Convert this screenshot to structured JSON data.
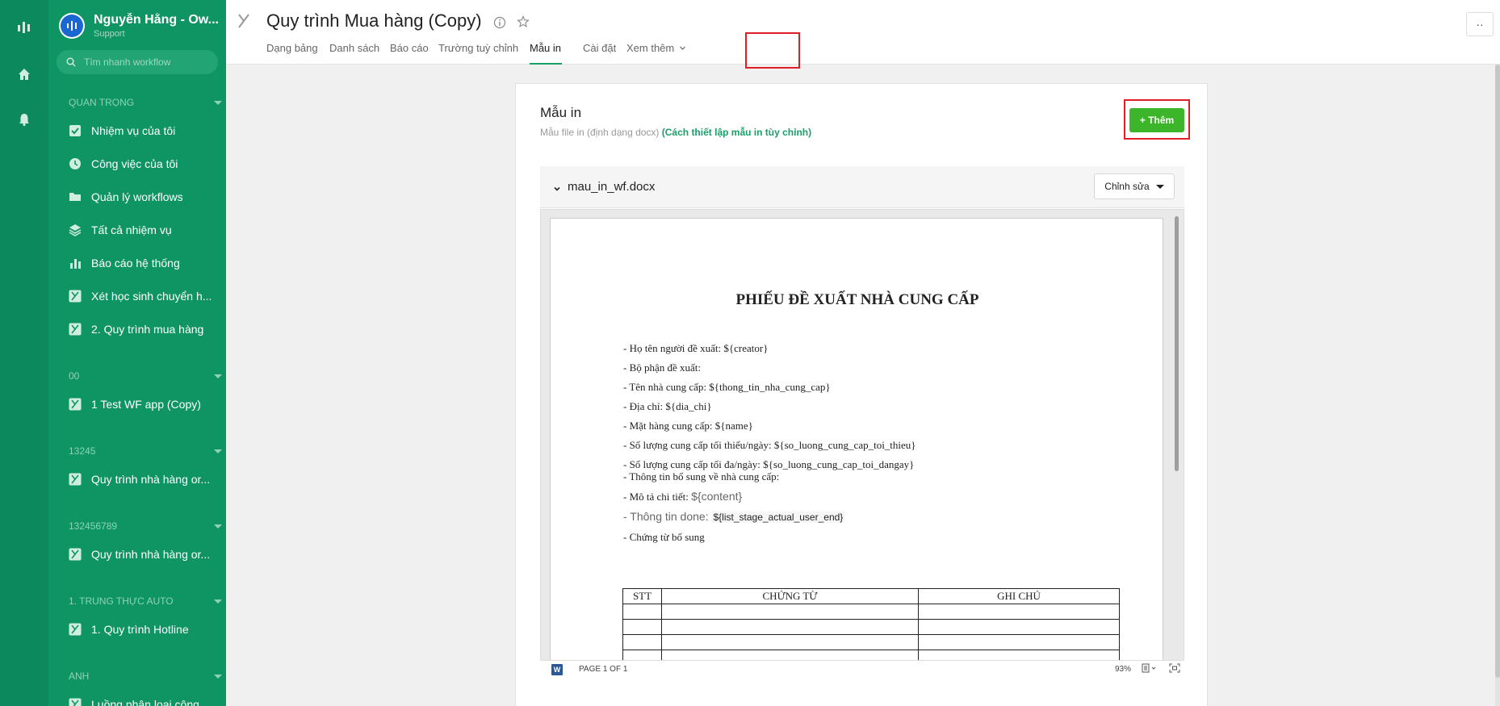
{
  "app": {
    "org_name": "Nguyễn Hằng - Ow...",
    "org_subtitle": "Support",
    "search_placeholder": "Tìm nhanh workflow"
  },
  "sidebar": {
    "sections": [
      {
        "title": "QUAN TRỌNG",
        "items": [
          {
            "label": "Nhiệm vụ của tôi",
            "icon": "check-square-icon"
          },
          {
            "label": "Công việc của tôi",
            "icon": "clock-icon"
          },
          {
            "label": "Quản lý workflows",
            "icon": "folder-icon"
          },
          {
            "label": "Tất cả nhiệm vụ",
            "icon": "layers-icon"
          },
          {
            "label": "Báo cáo hệ thống",
            "icon": "bar-chart-icon"
          },
          {
            "label": "Xét học sinh chuyển h...",
            "icon": "workflow-icon"
          },
          {
            "label": "2. Quy trình mua hàng",
            "icon": "workflow-icon"
          }
        ]
      },
      {
        "title": "00",
        "items": [
          {
            "label": "1 Test WF app (Copy)",
            "icon": "workflow-icon"
          }
        ]
      },
      {
        "title": "13245",
        "items": [
          {
            "label": "Quy trình nhà hàng or...",
            "icon": "workflow-icon"
          }
        ]
      },
      {
        "title": "132456789",
        "items": [
          {
            "label": "Quy trình nhà hàng or...",
            "icon": "workflow-icon"
          }
        ]
      },
      {
        "title": "1. TRUNG THỰC AUTO",
        "items": [
          {
            "label": "1. Quy trình Hotline",
            "icon": "workflow-icon"
          }
        ]
      },
      {
        "title": "ANH",
        "items": [
          {
            "label": "Luồng phân loại công...",
            "icon": "workflow-icon"
          }
        ]
      }
    ]
  },
  "header": {
    "title": "Quy trình Mua hàng (Copy)",
    "tabs": [
      "Dạng bảng",
      "Danh sách",
      "Báo cáo",
      "Trường tuỳ chỉnh",
      "Mẫu in",
      "Cài đặt",
      "Xem thêm"
    ],
    "active_tab": "Mẫu in",
    "more_label": "··"
  },
  "card": {
    "title": "Mẫu in",
    "subtitle": "Mẫu file in (định dạng docx)",
    "subtitle_link": "(Cách thiết lập mẫu in tùy chỉnh)",
    "add_button": "+ Thêm"
  },
  "file": {
    "name": "mau_in_wf.docx",
    "edit_button": "Chỉnh sửa"
  },
  "document": {
    "title": "PHIẾU ĐỀ XUẤT NHÀ CUNG CẤP",
    "lines": [
      "- Họ tên người đề xuất: ${creator}",
      "- Bộ phận đề xuất:",
      "- Tên nhà cung cấp: ${thong_tin_nha_cung_cap}",
      "- Địa chỉ: ${dia_chi}",
      "- Mặt hàng cung cấp: ${name}",
      "- Số lượng cung cấp tối thiểu/ngày: ${so_luong_cung_cap_toi_thieu}",
      "- Số lượng cung cấp tối đa/ngày: ${so_luong_cung_cap_toi_dangay}",
      "- Thông tin bổ sung về nhà cung cấp:"
    ],
    "detail_label": "- Mô tả chi tiết:",
    "detail_var": "${content}",
    "done_label": "- Thông tin done:",
    "done_var": "${list_stage_actual_user_end}",
    "attachments_label": "- Chứng từ bổ sung",
    "table_headers": [
      "STT",
      "CHỨNG TỪ",
      "GHI CHÚ"
    ],
    "table_empty_rows": 4
  },
  "viewer": {
    "page_count": "PAGE 1 OF 1",
    "zoom": "93%",
    "word_icon_text": "W"
  },
  "colors": {
    "sidebar": "#0f9563",
    "rail": "#0c8a5e",
    "accent": "#19a069",
    "add_button": "#3cb52a",
    "highlight": "#e01e25"
  }
}
